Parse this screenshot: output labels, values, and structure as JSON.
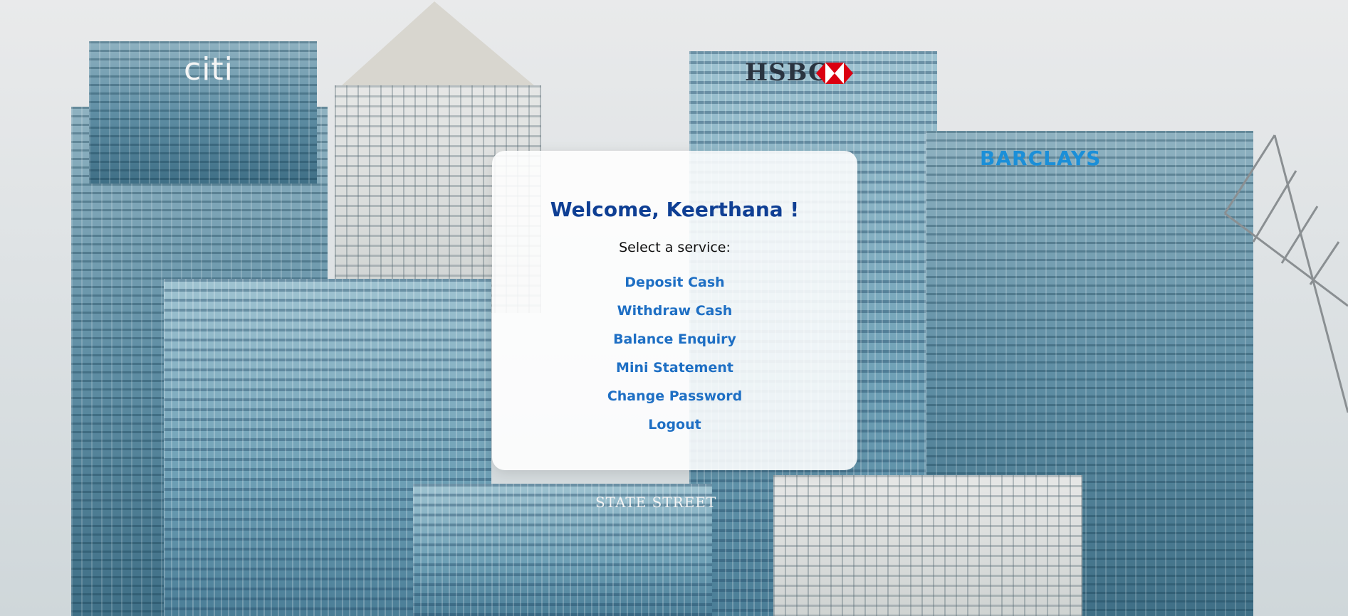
{
  "background": {
    "brands": [
      "citi",
      "HSBC",
      "BARCLAYS",
      "STATE STREET"
    ]
  },
  "card": {
    "welcome": "Welcome, Keerthana !",
    "prompt": "Select a service:",
    "services": [
      {
        "label": "Deposit Cash"
      },
      {
        "label": "Withdraw Cash"
      },
      {
        "label": "Balance Enquiry"
      },
      {
        "label": "Mini Statement"
      },
      {
        "label": "Change Password"
      },
      {
        "label": "Logout"
      }
    ]
  },
  "colors": {
    "welcome": "#0f3f94",
    "link": "#1e6fc4"
  }
}
